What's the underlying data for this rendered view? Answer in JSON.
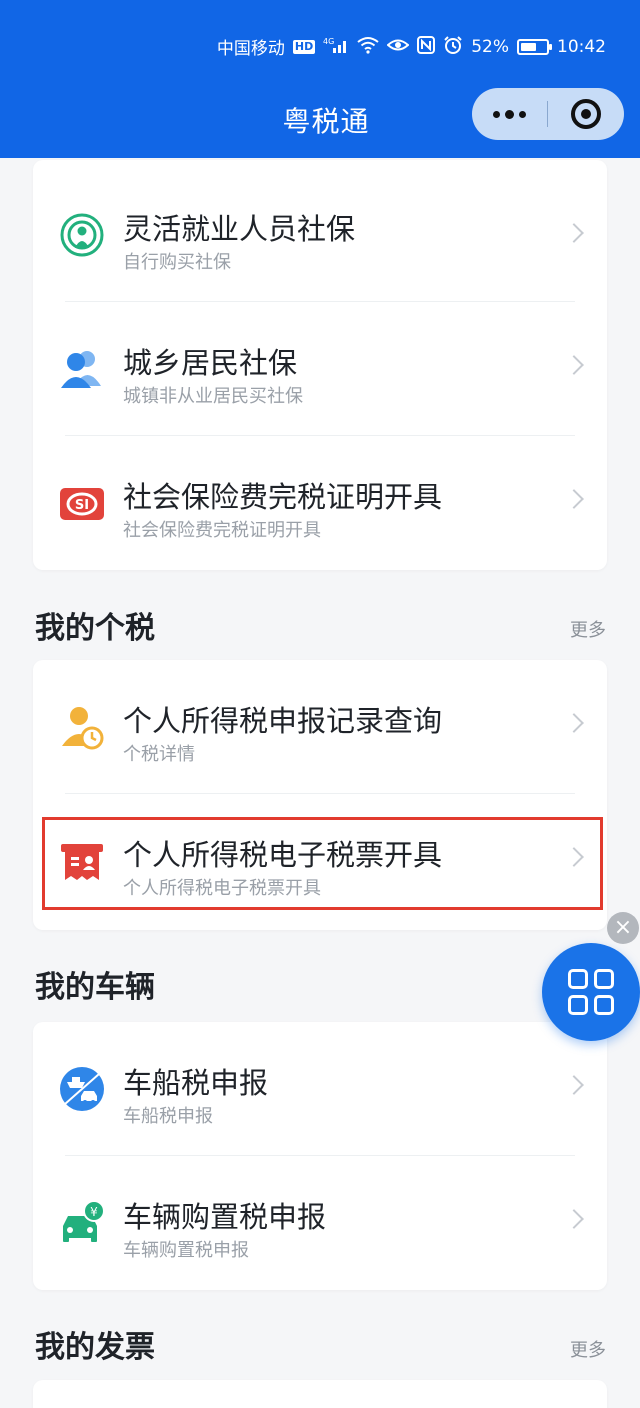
{
  "status_bar": {
    "carrier": "中国移动",
    "hd": "HD",
    "network": "⁴ᴳ",
    "battery": "52%",
    "battery_level": 0.52,
    "time": "10:42"
  },
  "header": {
    "title": "粤税通",
    "background": "#1166e6"
  },
  "social_security": {
    "items": [
      {
        "label": "灵活就业人员社保",
        "sub": "自行购买社保",
        "icon": "broadcast-person-icon",
        "color": "#22b07d"
      },
      {
        "label": "城乡居民社保",
        "sub": "城镇非从业居民买社保",
        "icon": "users-icon",
        "color": "#2f86e8"
      },
      {
        "label": "社会保险费完税证明开具",
        "sub": "社会保险费完税证明开具",
        "icon": "si-badge-icon",
        "color": "#e2433b"
      }
    ]
  },
  "personal_tax": {
    "title": "我的个税",
    "more": "更多",
    "items": [
      {
        "label": "个人所得税申报记录查询",
        "sub": "个税详情",
        "icon": "user-clock-icon",
        "color": "#f2b23a"
      },
      {
        "label": "个人所得税电子税票开具",
        "sub": "个人所得税电子税票开具",
        "icon": "ticket-icon",
        "color": "#e2433b"
      }
    ]
  },
  "vehicles": {
    "title": "我的车辆",
    "items": [
      {
        "label": "车船税申报",
        "sub": "车船税申报",
        "icon": "ship-car-icon",
        "color": "#2f86e8"
      },
      {
        "label": "车辆购置税申报",
        "sub": "车辆购置税申报",
        "icon": "car-yuan-icon",
        "color": "#22b07d"
      }
    ]
  },
  "invoices": {
    "title": "我的发票",
    "more": "更多"
  },
  "fab": {
    "close_glyph": "×",
    "icon": "grid-icon",
    "color": "#1a73e8"
  }
}
